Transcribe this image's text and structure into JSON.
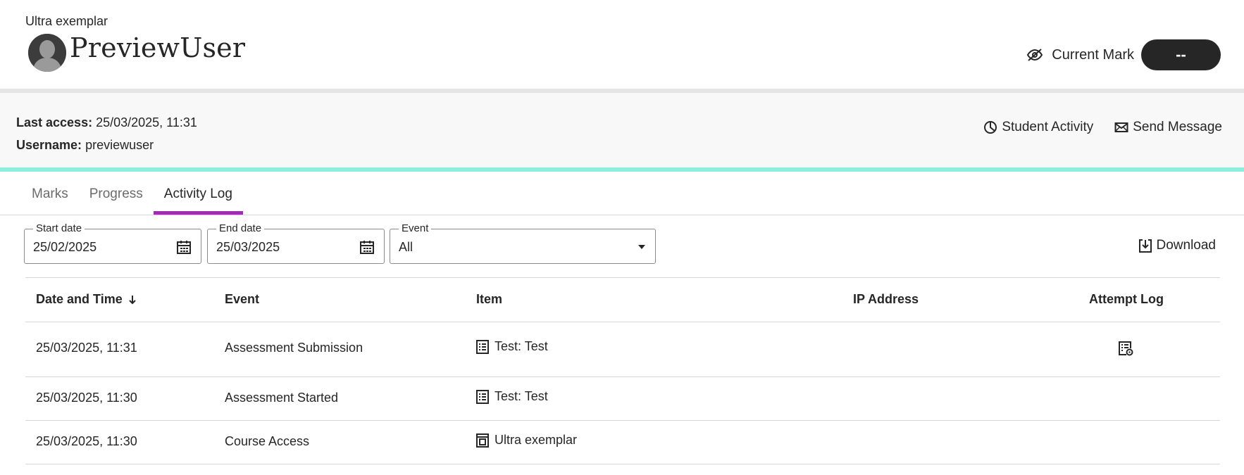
{
  "header": {
    "course_name": "Ultra exemplar",
    "user_name": "PreviewUser",
    "current_mark_label": "Current Mark",
    "current_mark_value": "--"
  },
  "info": {
    "last_access_label": "Last access:",
    "last_access_value": "25/03/2025, 11:31",
    "username_label": "Username:",
    "username_value": "previewuser"
  },
  "actions": {
    "student_activity": "Student Activity",
    "send_message": "Send Message"
  },
  "tabs": [
    {
      "label": "Marks",
      "active": false
    },
    {
      "label": "Progress",
      "active": false
    },
    {
      "label": "Activity Log",
      "active": true
    }
  ],
  "filters": {
    "start_date_label": "Start date",
    "start_date_value": "25/02/2025",
    "end_date_label": "End date",
    "end_date_value": "25/03/2025",
    "event_label": "Event",
    "event_value": "All",
    "download_label": "Download"
  },
  "table": {
    "headers": {
      "date": "Date and Time",
      "event": "Event",
      "item": "Item",
      "ip": "IP Address",
      "attempt": "Attempt Log"
    },
    "rows": [
      {
        "date": "25/03/2025, 11:31",
        "event": "Assessment Submission",
        "item": "Test: Test",
        "item_icon": "test-document-icon",
        "ip": "",
        "has_attempt_log": true
      },
      {
        "date": "25/03/2025, 11:30",
        "event": "Assessment Started",
        "item": "Test: Test",
        "item_icon": "test-document-icon",
        "ip": "",
        "has_attempt_log": false
      },
      {
        "date": "25/03/2025, 11:30",
        "event": "Course Access",
        "item": "Ultra exemplar",
        "item_icon": "course-icon",
        "ip": "",
        "has_attempt_log": false
      }
    ]
  },
  "colors": {
    "accent_tab": "#9b2fae",
    "teal_bar": "#8ceedd",
    "mark_pill": "#262626"
  }
}
